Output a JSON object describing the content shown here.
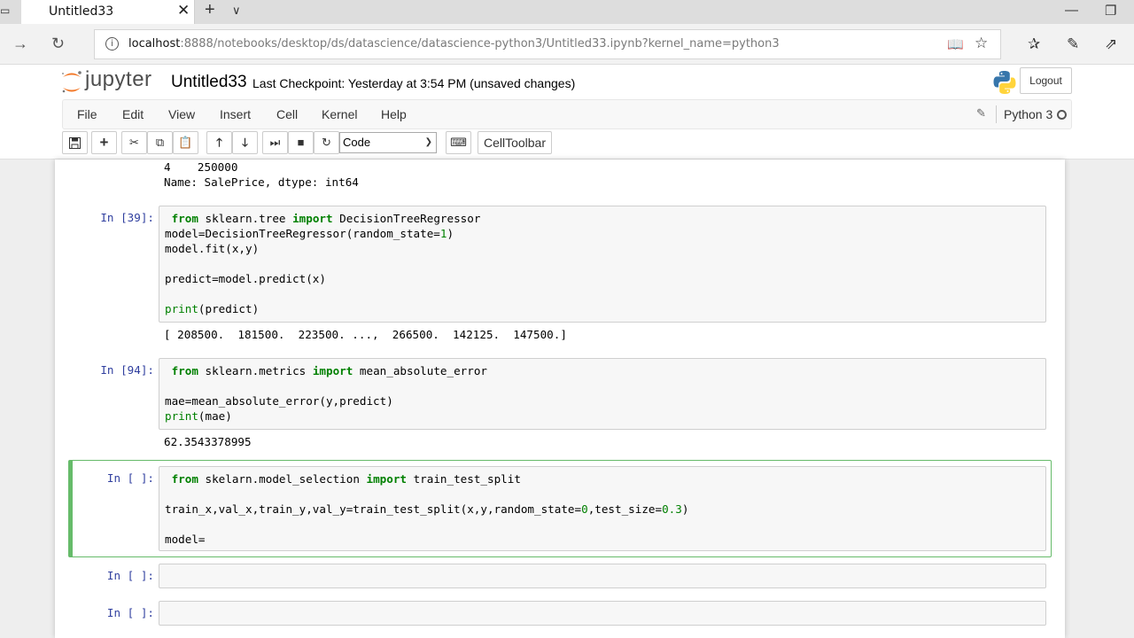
{
  "browser": {
    "tab_title": "Untitled33",
    "url_host": "localhost",
    "url_rest": ":8888/notebooks/desktop/ds/datascience/datascience-python3/Untitled33.ipynb?kernel_name=python3"
  },
  "header": {
    "logo_text": "jupyter",
    "notebook_name": "Untitled33",
    "checkpoint": "Last Checkpoint: Yesterday at 3:54 PM (unsaved changes)",
    "logout_label": "Logout"
  },
  "menu": {
    "items": [
      "File",
      "Edit",
      "View",
      "Insert",
      "Cell",
      "Kernel",
      "Help"
    ],
    "kernel_name": "Python 3"
  },
  "toolbar": {
    "cell_type": "Code",
    "celltoolbar_label": "CellToolbar"
  },
  "cells": {
    "prev_output": [
      "4    250000",
      "Name: SalePrice, dtype: int64"
    ],
    "c1": {
      "prompt": "In [39]:",
      "l1_kw": "from",
      "l1_a": " sklearn.tree ",
      "l1_kw2": "import",
      "l1_b": " DecisionTreeRegressor",
      "l2_a": "model=DecisionTreeRegressor(random_state=",
      "l2_num": "1",
      "l2_b": ")",
      "l3": "model.fit(x,y)",
      "l5": "predict=model.predict(x)",
      "l7_bi": "print",
      "l7_b": "(predict)",
      "output": "[ 208500.  181500.  223500. ...,  266500.  142125.  147500.]"
    },
    "c2": {
      "prompt": "In [94]:",
      "l1_kw": "from",
      "l1_a": " sklearn.metrics ",
      "l1_kw2": "import",
      "l1_b": " mean_absolute_error",
      "l3": "mae=mean_absolute_error(y,predict)",
      "l4_bi": "print",
      "l4_b": "(mae)",
      "output": "62.3543378995"
    },
    "c3": {
      "prompt": "In [ ]:",
      "l1_kw": "from",
      "l1_a": " skelarn.model_selection ",
      "l1_kw2": "import",
      "l1_b": " train_test_split",
      "l3_a": "train_x,val_x,train_y,val_y=train_test_split(x,y,random_state=",
      "l3_num1": "0",
      "l3_b": ",test_size=",
      "l3_num2": "0.3",
      "l3_c": ")",
      "l5": "model="
    },
    "c4": {
      "prompt": "In [ ]:"
    },
    "c5": {
      "prompt": "In [ ]:"
    }
  },
  "colors": {
    "keyword": "#008000",
    "prompt": "#303f9f",
    "selected_border": "#66bb6a"
  }
}
